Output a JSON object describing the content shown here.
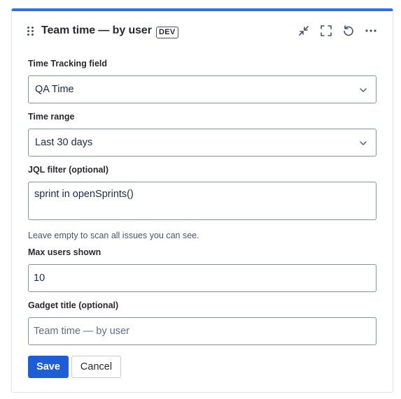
{
  "gadget": {
    "title": "Team time — by user",
    "badge": "DEV",
    "accent_color": "#2f6fea",
    "toolbar_icons": [
      "minimize-icon",
      "fullscreen-icon",
      "refresh-icon",
      "more-icon"
    ]
  },
  "form": {
    "time_tracking_field": {
      "label": "Time Tracking field",
      "value": "QA Time"
    },
    "time_range": {
      "label": "Time range",
      "value": "Last 30 days"
    },
    "jql_filter": {
      "label": "JQL filter (optional)",
      "value": "sprint in openSprints()",
      "help": "Leave empty to scan all issues you can see."
    },
    "max_users": {
      "label": "Max users shown",
      "value": "10"
    },
    "gadget_title": {
      "label": "Gadget title (optional)",
      "placeholder": "Team time — by user"
    }
  },
  "actions": {
    "save_label": "Save",
    "cancel_label": "Cancel",
    "save_color": "#1d5ed7"
  }
}
